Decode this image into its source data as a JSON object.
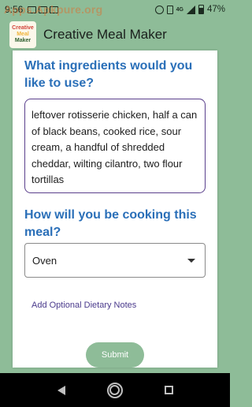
{
  "status_bar": {
    "time": "9:56",
    "watermark": "Apps.Apkpure.org",
    "network": "4G",
    "battery": "47%"
  },
  "app": {
    "title": "Creative Meal Maker",
    "logo_text": [
      "Creative",
      "Meal",
      "Maker"
    ]
  },
  "form": {
    "ingredients_question": "What ingredients would you like to use?",
    "ingredients_value": "leftover rotisserie chicken, half a can of black beans, cooked rice, sour cream, a handful of shredded cheddar, wilting cilantro, two flour tortillas",
    "cooking_question": "How will you be cooking this meal?",
    "cooking_method_selected": "Oven",
    "dietary_notes_link": "Add Optional Dietary Notes",
    "submit_label": "Submit"
  },
  "colors": {
    "accent_green": "#8ebc98",
    "question_blue": "#2a6fb8",
    "input_border_purple": "#5a3f8c"
  },
  "icons": {
    "nav_back": "back-triangle-icon",
    "nav_home": "home-circle-icon",
    "nav_recent": "recent-apps-square-icon",
    "dropdown": "caret-down-icon"
  }
}
